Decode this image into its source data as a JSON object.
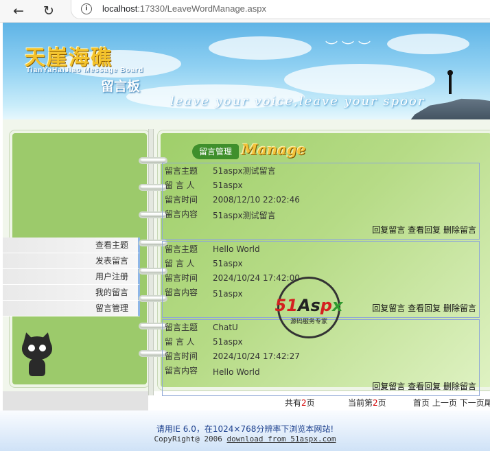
{
  "browser": {
    "url_host": "localhost",
    "url_rest": ":17330/LeaveWordManage.aspx"
  },
  "banner": {
    "logo_cn": "天崖海礁",
    "logo_en": "TianYaHaiJiao Message Board",
    "logo_sub": "留言板",
    "slogan": "leave your voice,leave your spoor"
  },
  "menu": [
    {
      "label": "查看主题"
    },
    {
      "label": "发表留言"
    },
    {
      "label": "用户注册"
    },
    {
      "label": "我的留言"
    },
    {
      "label": "留言管理"
    }
  ],
  "section": {
    "title_cn": "留言管理",
    "title_en": "Manage"
  },
  "labels": {
    "subject": "留言主题",
    "author": "留 言 人",
    "time": "留言时间",
    "content": "留言内容"
  },
  "actions": {
    "reply": "回复留言",
    "view_reply": "查看回复",
    "delete": "删除留言"
  },
  "messages": [
    {
      "subject": "51aspx测试留言",
      "author": "51aspx",
      "time": "2008/12/10 22:02:46",
      "content": "51aspx测试留言"
    },
    {
      "subject": "Hello World",
      "author": "51aspx",
      "time": "2024/10/24 17:42:00",
      "content": "51aspx"
    },
    {
      "subject": "ChatU",
      "author": "51aspx",
      "time": "2024/10/24 17:42:27",
      "content": "Hello World"
    }
  ],
  "pager": {
    "total_prefix": "共有",
    "total_pages": "2",
    "total_suffix": "页",
    "current_prefix": "当前第",
    "current_page": "2",
    "current_suffix": "页",
    "first": "首页",
    "prev": "上一页",
    "next": "下一页",
    "last": "尾"
  },
  "footer": {
    "line1": "请用IE 6.0，在1024×768分辨率下浏览本网站!",
    "line2_prefix": "CopyRight@ 2006 ",
    "line2_link": "download from 51aspx.com"
  },
  "watermark": {
    "brand_part1": "51",
    "brand_part2": "As",
    "brand_part3": "p",
    "brand_part4": "x",
    "tagline": "源码服务专家"
  }
}
